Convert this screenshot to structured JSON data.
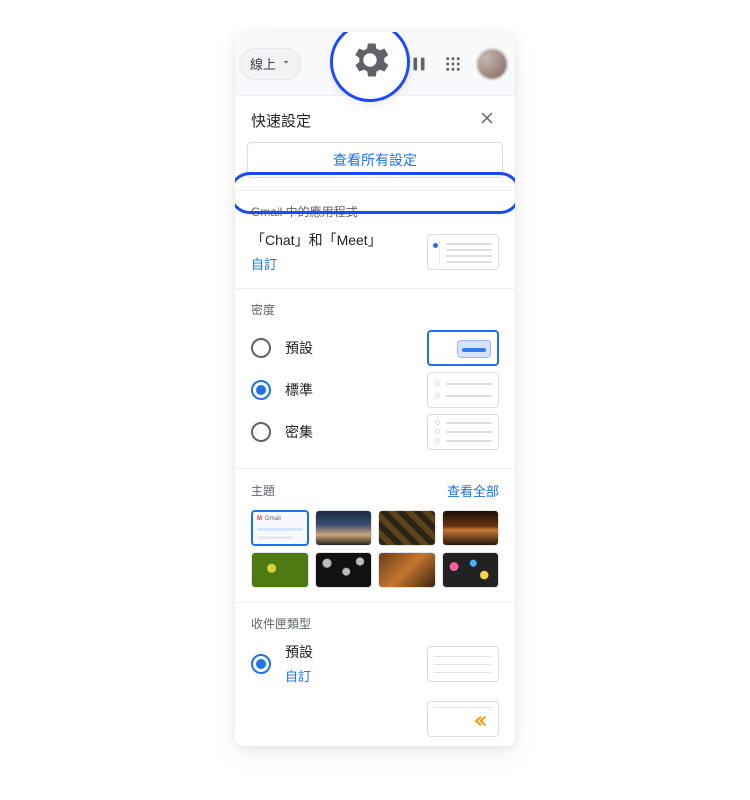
{
  "appbar": {
    "status_label": "線上"
  },
  "panel": {
    "title": "快速設定",
    "all_settings_label": "查看所有設定"
  },
  "apps_section": {
    "heading": "Gmail 中的應用程式",
    "item_label": "「Chat」和「Meet」",
    "customize_label": "自訂"
  },
  "density": {
    "heading": "密度",
    "options": [
      {
        "label": "預設",
        "checked": false
      },
      {
        "label": "標準",
        "checked": true
      },
      {
        "label": "密集",
        "checked": false
      }
    ]
  },
  "theme": {
    "heading": "主題",
    "view_all_label": "查看全部"
  },
  "inbox": {
    "heading": "收件匣類型",
    "options": [
      {
        "label": "預設",
        "customize_label": "自訂",
        "checked": true
      }
    ]
  }
}
